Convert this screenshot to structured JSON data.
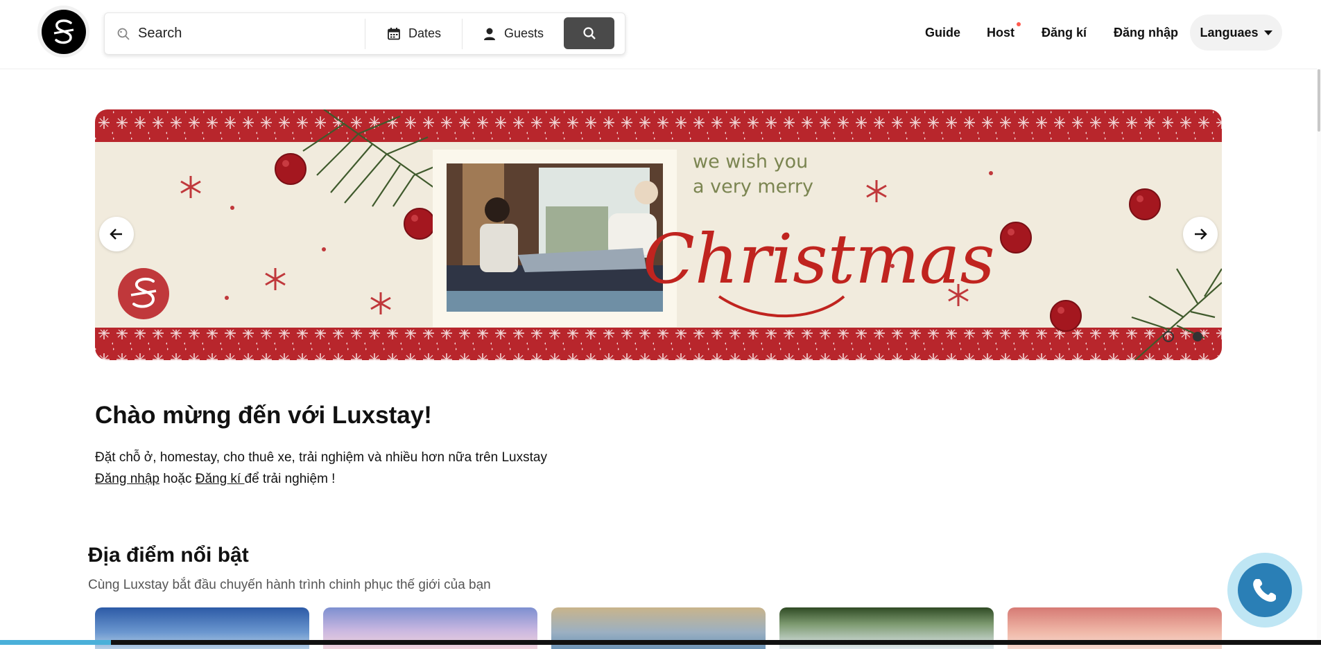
{
  "header": {
    "search_label": "Search",
    "dates_label": "Dates",
    "guests_label": "Guests",
    "nav": {
      "guide": "Guide",
      "host": "Host",
      "register": "Đăng kí",
      "login": "Đăng nhập",
      "languages": "Languaes"
    }
  },
  "banner": {
    "line1": "we wish you",
    "line2": "a very merry",
    "script": "Christmas",
    "colors": {
      "red": "#b8262c",
      "cream": "#f1ebdd",
      "olive": "#7b8551"
    }
  },
  "welcome": {
    "title": "Chào mừng đến với Luxstay!",
    "line1": "Đặt chỗ ở, homestay, cho thuê xe, trải nghiệm và nhiều hơn nữa trên Luxstay",
    "login_link": "Đăng nhập",
    "or_text": " hoặc ",
    "register_link": "Đăng kí ",
    "tail": "để trải nghiệm !"
  },
  "featured": {
    "title": "Địa điểm nổi bật",
    "subtitle": "Cùng Luxstay bắt đầu chuyến hành trình chinh phục thế giới của bạn"
  },
  "icons": [
    "search-icon",
    "calendar-icon",
    "user-icon",
    "arrow-left-icon",
    "arrow-right-icon",
    "phone-icon"
  ]
}
